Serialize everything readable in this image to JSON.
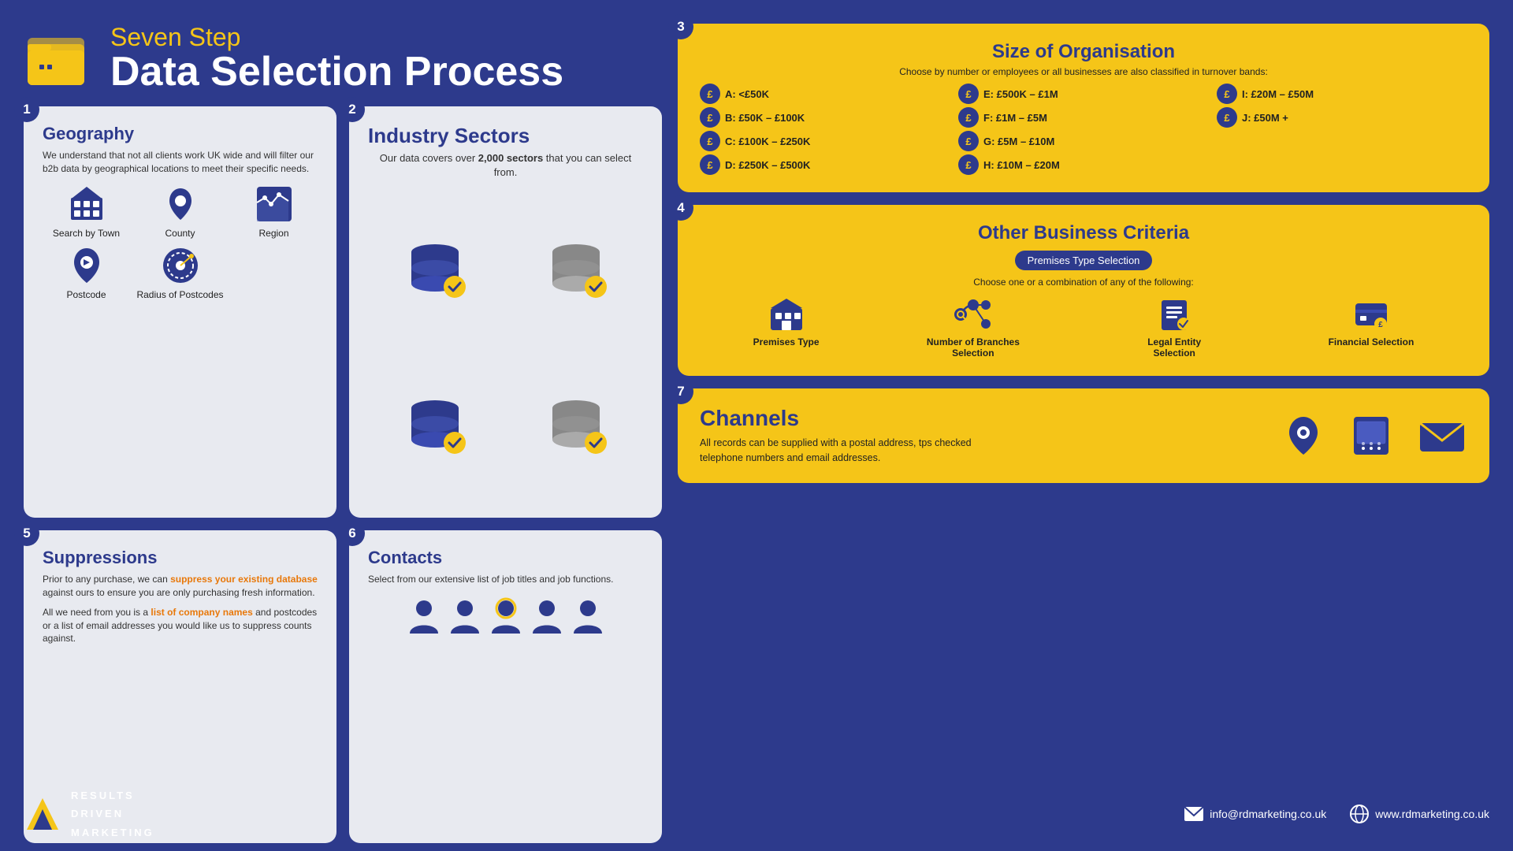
{
  "header": {
    "subtitle": "Seven Step",
    "title": "Data Selection Process"
  },
  "steps": {
    "geography": {
      "step": "1",
      "title": "Geography",
      "description": "We understand that not all clients work UK wide and will filter our b2b data by geographical locations to meet their specific needs.",
      "items": [
        {
          "label": "Search by Town",
          "icon": "building"
        },
        {
          "label": "County",
          "icon": "map-pin"
        },
        {
          "label": "Region",
          "icon": "region"
        },
        {
          "label": "Postcode",
          "icon": "postcode"
        },
        {
          "label": "Radius of Postcodes",
          "icon": "radius"
        }
      ]
    },
    "industry": {
      "step": "2",
      "title": "Industry Sectors",
      "description": "Our data covers over 2,000 sectors that you can select from.",
      "highlight": "2,000"
    },
    "size": {
      "step": "3",
      "title": "Size of Organisation",
      "description": "Choose by number or employees or all businesses are also classified in turnover bands:",
      "bands": [
        {
          "label": "A: <£50K"
        },
        {
          "label": "E: £500K – £1M"
        },
        {
          "label": "I: £20M – £50M"
        },
        {
          "label": "B: £50K – £100K"
        },
        {
          "label": "F: £1M – £5M"
        },
        {
          "label": "J: £50M +"
        },
        {
          "label": "C: £100K – £250K"
        },
        {
          "label": "G: £5M – £10M"
        },
        {
          "label": ""
        },
        {
          "label": "D: £250K – £500K"
        },
        {
          "label": "H: £10M – £20M"
        },
        {
          "label": ""
        }
      ]
    },
    "criteria": {
      "step": "4",
      "title": "Other Business Criteria",
      "badge": "Premises Type Selection",
      "description": "Choose one or a combination of any of the following:",
      "items": [
        {
          "label": "Premises Type",
          "icon": "building-icon"
        },
        {
          "label": "Number of Branches Selection",
          "icon": "branches-icon"
        },
        {
          "label": "Legal Entity Selection",
          "icon": "legal-icon"
        },
        {
          "label": "Financial Selection",
          "icon": "financial-icon"
        }
      ]
    },
    "suppressions": {
      "step": "5",
      "title": "Suppressions",
      "para1": "Prior to any purchase, we can suppress your existing database against ours to ensure you are only purchasing fresh information.",
      "para2_pre": "All we need from you is a ",
      "para2_highlight": "list of company names",
      "para2_post": " and postcodes or a list of email addresses you would like us to suppress counts against.",
      "highlight_suppress": "suppress your existing database"
    },
    "contacts": {
      "step": "6",
      "title": "Contacts",
      "description": "Select from our extensive list of job titles and job functions."
    },
    "channels": {
      "step": "7",
      "title": "Channels",
      "description": "All records can be supplied with a postal address, tps checked telephone numbers and email addresses."
    }
  },
  "footer": {
    "logo_line1": "RESULTS",
    "logo_line2": "DRIVEN",
    "logo_line3": "MARKETING",
    "email": "info@rdmarketing.co.uk",
    "website": "www.rdmarketing.co.uk"
  }
}
